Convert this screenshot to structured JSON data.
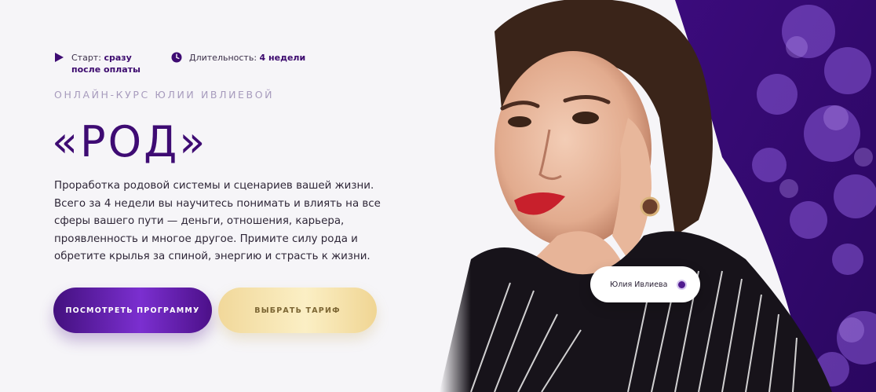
{
  "meta": {
    "start_label": "Старт:",
    "start_value": "сразу после оплаты",
    "duration_label": "Длительность:",
    "duration_value": "4 недели",
    "start_icon": "play-icon",
    "duration_icon": "clock-icon"
  },
  "hero": {
    "overline": "Онлайн-курс Юлии Ивлиевой",
    "title": "«РОД»",
    "description": "Проработка родовой системы и сценариев вашей жизни. Всего за 4 недели вы научитесь понимать и влиять на все сферы вашего пути — деньги, отношения, карьера, проявленность и многое другое. Примите силу рода и обретите крылья за спиной, энергию и страсть к жизни."
  },
  "buttons": {
    "program": "Посмотреть программу",
    "tariff": "Выбрать тариф"
  },
  "author_badge": {
    "name": "Юлия Ивлиева"
  },
  "colors": {
    "accent_purple": "#3e0b73",
    "background": "#f6f5f8",
    "art_purple": "#3a0d7a",
    "gold": "#f3dc9f"
  }
}
